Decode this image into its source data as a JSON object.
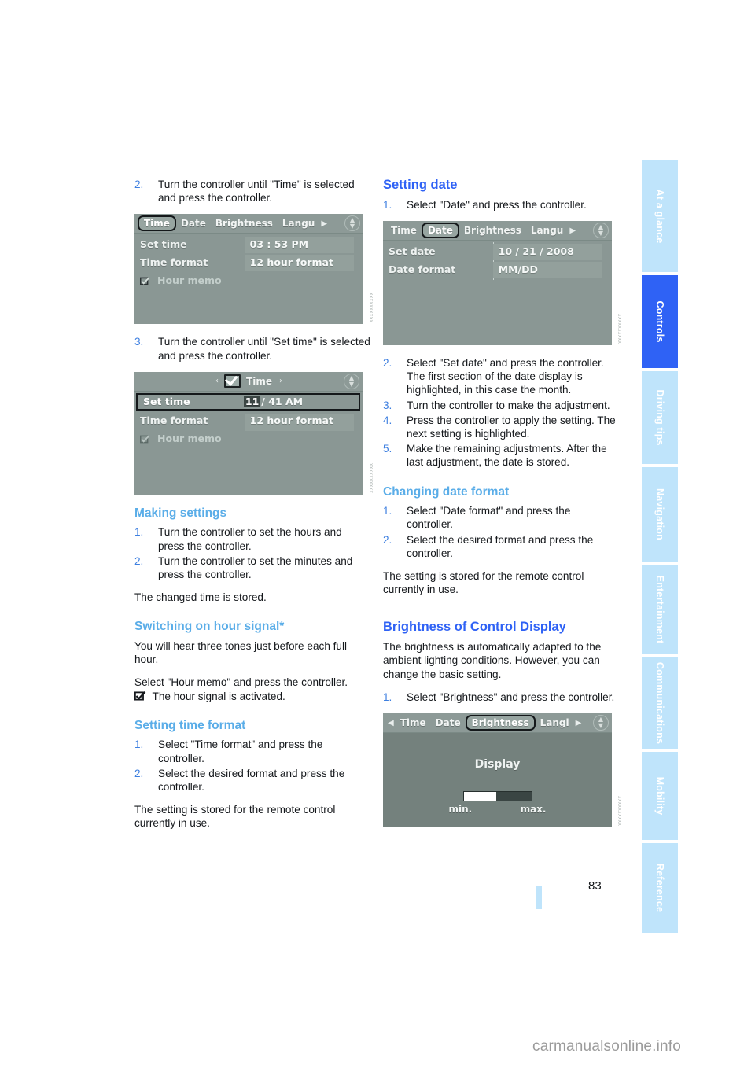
{
  "page": {
    "number": "83",
    "watermark": "carmanualsonline.info"
  },
  "tabs": [
    {
      "label": "At a glance",
      "active": false
    },
    {
      "label": "Controls",
      "active": true
    },
    {
      "label": "Driving tips",
      "active": false
    },
    {
      "label": "Navigation",
      "active": false
    },
    {
      "label": "Entertainment",
      "active": false
    },
    {
      "label": "Communications",
      "active": false
    },
    {
      "label": "Mobility",
      "active": false
    },
    {
      "label": "Reference",
      "active": false
    }
  ],
  "left_column": {
    "step2": {
      "num": "2.",
      "text": "Turn the controller until \"Time\" is selected and press the controller."
    },
    "figure_time": {
      "id_code": "XXXXXXXXXX",
      "menu": {
        "items": [
          "Time",
          "Date",
          "Brightness",
          "Langu"
        ],
        "selected": "Time",
        "right_arrow": "▶"
      },
      "rows": [
        {
          "label": "Set time",
          "value": "03 : 53 PM"
        },
        {
          "label": "Time format",
          "value": "12 hour format"
        },
        {
          "label": "Hour memo",
          "value": ""
        }
      ]
    },
    "step3": {
      "num": "3.",
      "text": "Turn the controller until \"Set time\" is selected and press the controller."
    },
    "figure_settime": {
      "id_code": "XXXXXXXXXX",
      "title": "Time",
      "left_arrow": "‹",
      "right_arrow": "›",
      "rows": [
        {
          "label": "Set time",
          "value_hl": "11",
          "value_rest": "/ 41 AM"
        },
        {
          "label": "Time format",
          "value": "12 hour format"
        },
        {
          "label": "Hour memo",
          "value": ""
        }
      ]
    },
    "making_settings": {
      "heading": "Making settings",
      "steps": [
        {
          "num": "1.",
          "text": "Turn the controller to set the hours and press the controller."
        },
        {
          "num": "2.",
          "text": "Turn the controller to set the minutes and press the controller."
        }
      ],
      "note": "The changed time is stored."
    },
    "hour_signal": {
      "heading": "Switching on hour signal*",
      "paragraph1": "You will hear three tones just before each full hour.",
      "paragraph2": "Select \"Hour memo\" and press the controller.",
      "paragraph3": "The hour signal is activated."
    },
    "time_format": {
      "heading": "Setting time format",
      "steps": [
        {
          "num": "1.",
          "text": "Select \"Time format\" and press the controller."
        },
        {
          "num": "2.",
          "text": "Select the desired format and press the controller."
        }
      ],
      "note": "The setting is stored for the remote control currently in use."
    }
  },
  "right_column": {
    "setting_date": {
      "heading": "Setting date",
      "step1": {
        "num": "1.",
        "text": "Select \"Date\" and press the controller."
      }
    },
    "figure_date": {
      "id_code": "XXXXXXXXXX",
      "menu": {
        "items": [
          "Time",
          "Date",
          "Brightness",
          "Langu"
        ],
        "selected": "Date",
        "right_arrow": "▶"
      },
      "rows": [
        {
          "label": "Set date",
          "value": "10 / 21 / 2008"
        },
        {
          "label": "Date format",
          "value": "MM/DD"
        }
      ]
    },
    "date_steps": [
      {
        "num": "2.",
        "text": "Select \"Set date\" and press the controller. The first section of the date display is highlighted, in this case the month."
      },
      {
        "num": "3.",
        "text": "Turn the controller to make the adjustment."
      },
      {
        "num": "4.",
        "text": "Press the controller to apply the setting. The next setting is highlighted."
      },
      {
        "num": "5.",
        "text": "Make the remaining adjustments. After the last adjustment, the date is stored."
      }
    ],
    "date_format": {
      "heading": "Changing date format",
      "steps": [
        {
          "num": "1.",
          "text": "Select \"Date format\" and press the controller."
        },
        {
          "num": "2.",
          "text": "Select the desired format and press the controller."
        }
      ],
      "note": "The setting is stored for the remote control currently in use."
    },
    "brightness": {
      "heading": "Brightness of Control Display",
      "paragraph": "The brightness is automatically adapted to the ambient lighting conditions. However, you can change the basic setting.",
      "step1": {
        "num": "1.",
        "text": "Select \"Brightness\" and press the controller."
      }
    },
    "figure_brightness": {
      "id_code": "XXXXXXXXXX",
      "menu": {
        "items": [
          "Time",
          "Date",
          "Brightness",
          "Langi"
        ],
        "selected": "Brightness",
        "left_arrow": "◀",
        "right_arrow": "▶"
      },
      "title": "Display",
      "slider_percent": 48,
      "min_label": "min.",
      "max_label": "max."
    }
  },
  "colors": {
    "accent_heading": "#5aade8",
    "accent_heading_strong": "#2f62f5",
    "step_number": "#3d7fe0",
    "tab_inactive": "#bfe4fb",
    "tab_active": "#2f62f5",
    "screen_bg": "#8a9794"
  }
}
